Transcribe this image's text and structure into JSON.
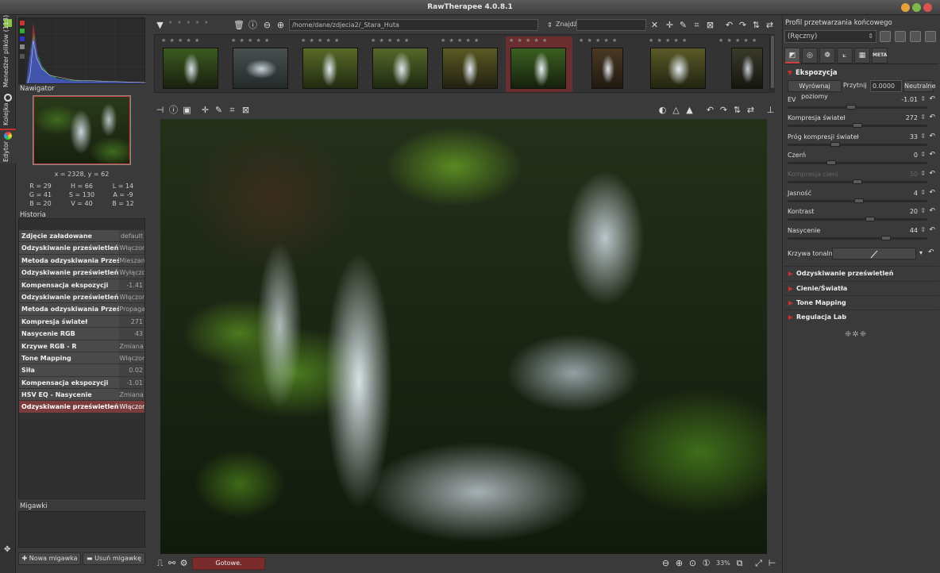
{
  "window": {
    "title": "RawTherapee 4.0.8.1"
  },
  "vertical_tabs": [
    "Menedżer plików (113)",
    "Kolejka",
    "Edytor"
  ],
  "navigator": {
    "title": "Nawigator",
    "coords": "x = 2328, y = 62",
    "values": [
      [
        "R = 29",
        "H = 66",
        "L = 14"
      ],
      [
        "G = 41",
        "S = 130",
        "A = -9"
      ],
      [
        "B = 20",
        "V = 40",
        "B = 12"
      ]
    ]
  },
  "history": {
    "title": "Historia",
    "rows": [
      {
        "name": "Zdjęcie załadowane",
        "value": "default"
      },
      {
        "name": "Odzyskiwanie prześwietleń",
        "value": "Włączone"
      },
      {
        "name": "Metoda odzyskiwania Prześwietleń",
        "value": "Mieszanie"
      },
      {
        "name": "Odzyskiwanie prześwietleń",
        "value": "Wyłączone"
      },
      {
        "name": "Kompensacja ekspozycji",
        "value": "-1.41"
      },
      {
        "name": "Odzyskiwanie prześwietleń",
        "value": "Włączone"
      },
      {
        "name": "Metoda odzyskiwania Prześwietleń",
        "value": "Propagacja koloru"
      },
      {
        "name": "Kompresja świateł",
        "value": "271"
      },
      {
        "name": "Nasycenie RGB",
        "value": "43"
      },
      {
        "name": "Krzywe RGB - R",
        "value": "Zmiana krzywa"
      },
      {
        "name": "Tone Mapping",
        "value": "Włączone"
      },
      {
        "name": "Siła",
        "value": "0.02"
      },
      {
        "name": "Kompensacja ekspozycji",
        "value": "-1.01"
      },
      {
        "name": "HSV EQ - Nasycenie",
        "value": "Zmiana krzywa"
      },
      {
        "name": "Odzyskiwanie prześwietleń",
        "value": "Włączone"
      }
    ]
  },
  "snapshots": {
    "title": "Migawki",
    "new_label": "Nowa migawka",
    "delete_label": "Usuń migawkę"
  },
  "filebrowser": {
    "path": "/home/dane/zdjecia2/_Stara_Huta",
    "find_label": "Znajdź:",
    "rating_stars": "★ ★ ★ ★ ★"
  },
  "status": {
    "text": "Gotowe.",
    "zoom": "33%"
  },
  "right": {
    "profile_title": "Profil przetwarzania końcowego",
    "profile_value": "(Ręczny)",
    "exposure": {
      "title": "Ekspozycja",
      "auto_levels": "Wyrównaj poziomy",
      "clip_label": "Przytnij",
      "clip_value": "0.0000",
      "neutral": "Neutralne",
      "sliders": [
        {
          "label": "EV",
          "value": "-1.01",
          "fraction": 0.45
        },
        {
          "label": "Kompresja świateł",
          "value": "272",
          "fraction": 0.5
        },
        {
          "label": "Próg kompresji świateł",
          "value": "33",
          "fraction": 0.33
        },
        {
          "label": "Czerń",
          "value": "0",
          "fraction": 0.3
        },
        {
          "label": "Kompresja cieni",
          "value": "50",
          "fraction": 0.5,
          "disabled": true
        },
        {
          "label": "Jasność",
          "value": "4",
          "fraction": 0.51
        },
        {
          "label": "Kontrast",
          "value": "20",
          "fraction": 0.6
        },
        {
          "label": "Nasycenie",
          "value": "44",
          "fraction": 0.72
        }
      ],
      "curve_label": "Krzywa tonalna:"
    },
    "sections": [
      "Odzyskiwanie prześwietleń",
      "Cienie/Światła",
      "Tone Mapping",
      "Regulacja Lab"
    ],
    "tool_tabs": [
      "exposure-tab",
      "detail-tab",
      "color-tab",
      "transform-tab",
      "raw-tab",
      "META"
    ]
  }
}
